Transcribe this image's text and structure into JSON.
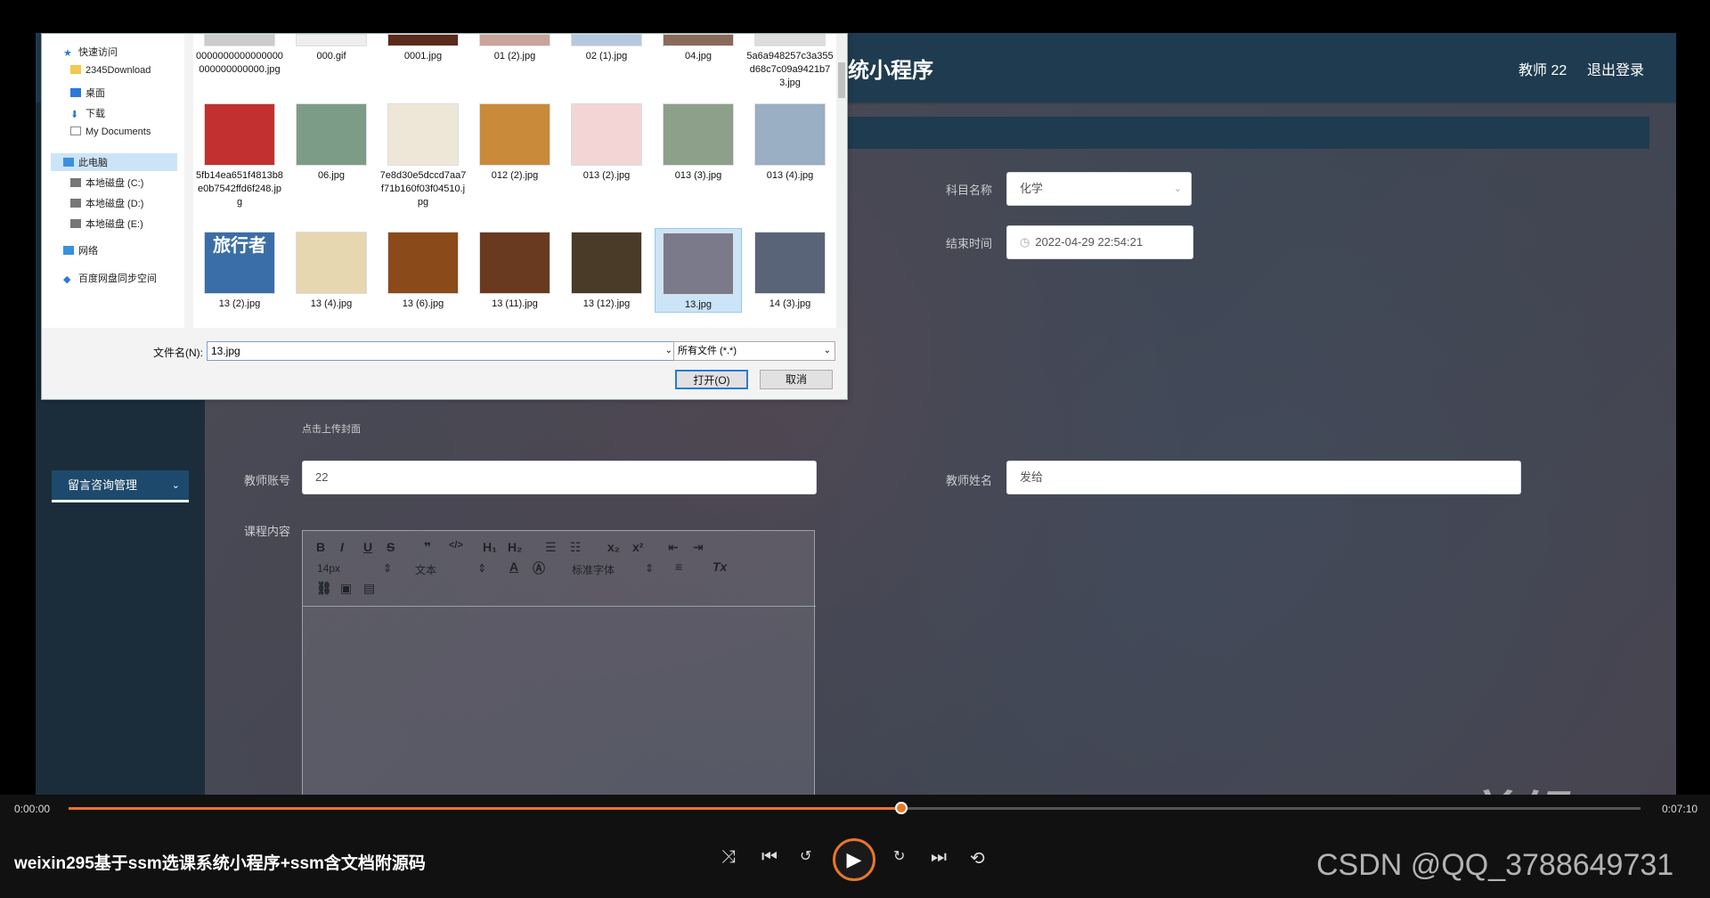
{
  "app": {
    "system_title": "统小程序",
    "teacher_label": "教师 22",
    "logout_label": "退出登录",
    "sidebar_menu_label": "留言咨询管理",
    "form": {
      "subject_label": "科目名称",
      "subject_value": "化学",
      "end_time_label": "结束时间",
      "end_time_value": "2022-04-29 22:54:21",
      "upload_hint": "点击上传封面",
      "teacher_account_label": "教师账号",
      "teacher_account_value": "22",
      "teacher_name_label": "教师姓名",
      "teacher_name_value": "发给",
      "content_label": "课程内容"
    },
    "editor_toolbar": {
      "font_size": "14px",
      "text_style": "文本",
      "font_family": "标准字体"
    }
  },
  "dialog": {
    "nav_items": [
      "快速访问",
      "2345Download",
      "桌面",
      "下载",
      "My Documents",
      "此电脑",
      "本地磁盘 (C:)",
      "本地磁盘 (D:)",
      "本地磁盘 (E:)",
      "网络",
      "百度网盘同步空间"
    ],
    "files_row0": [
      "0000000000000000000000000000.jpg",
      "000.gif",
      "0001.jpg",
      "01 (2).jpg",
      "02 (1).jpg",
      "04.jpg",
      "5a6a948257c3a355d68c7c09a9421b73.jpg"
    ],
    "files_row1": [
      "5fb14ea651f4813b8e0b7542ffd6f248.jpg",
      "06.jpg",
      "7e8d30e5dccd7aa7f71b160f03f04510.jpg",
      "012 (2).jpg",
      "013 (2).jpg",
      "013 (3).jpg",
      "013 (4).jpg"
    ],
    "files_row2": [
      "13 (2).jpg",
      "13 (4).jpg",
      "13 (6).jpg",
      "13 (11).jpg",
      "13 (12).jpg",
      "13.jpg",
      "14 (3).jpg"
    ],
    "filename_label": "文件名(N):",
    "filename_value": "13.jpg",
    "filetype_value": "所有文件 (*.*)",
    "open_label": "打开(O)",
    "cancel_label": "取消",
    "thumb_text_travel": "旅行者"
  },
  "player": {
    "time_current": "0:00:00",
    "time_total": "0:07:10",
    "progress": 0.53,
    "video_title": "weixin295基于ssm选课系统小程序+ssm含文档附源码",
    "watermark_ev": "eV剪辑",
    "watermark_csdn": "CSDN @QQ_3788649731"
  }
}
